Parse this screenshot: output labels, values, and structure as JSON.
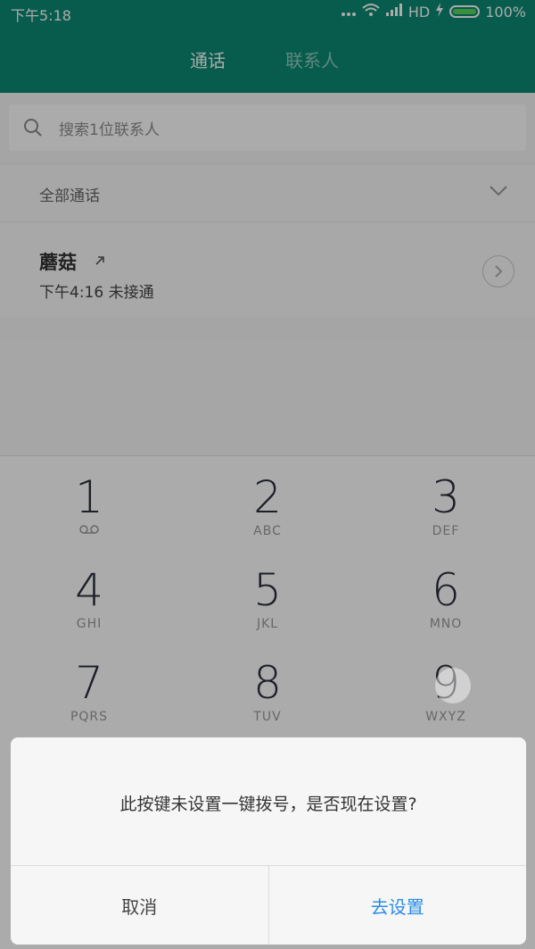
{
  "status_bar": {
    "time": "下午5:18",
    "network": "HD",
    "battery": "100%"
  },
  "tabs": [
    {
      "label": "通话"
    },
    {
      "label": "联系人"
    }
  ],
  "search": {
    "placeholder": "搜索1位联系人"
  },
  "filter": {
    "label": "全部通话"
  },
  "call_log": [
    {
      "name": "蘑菇",
      "time": "下午4:16",
      "status": "未接通"
    }
  ],
  "dialpad": {
    "keys": [
      {
        "digit": "1",
        "letters": ""
      },
      {
        "digit": "2",
        "letters": "ABC"
      },
      {
        "digit": "3",
        "letters": "DEF"
      },
      {
        "digit": "4",
        "letters": "GHI"
      },
      {
        "digit": "5",
        "letters": "JKL"
      },
      {
        "digit": "6",
        "letters": "MNO"
      },
      {
        "digit": "7",
        "letters": "PQRS"
      },
      {
        "digit": "8",
        "letters": "TUV"
      },
      {
        "digit": "9",
        "letters": "WXYZ"
      }
    ]
  },
  "dialog": {
    "message": "此按键未设置一键拨号，是否现在设置?",
    "cancel_label": "取消",
    "confirm_label": "去设置"
  },
  "colors": {
    "header": "#0b8a73",
    "accent_blue": "#2a8ee6",
    "battery": "#5ad35a"
  }
}
